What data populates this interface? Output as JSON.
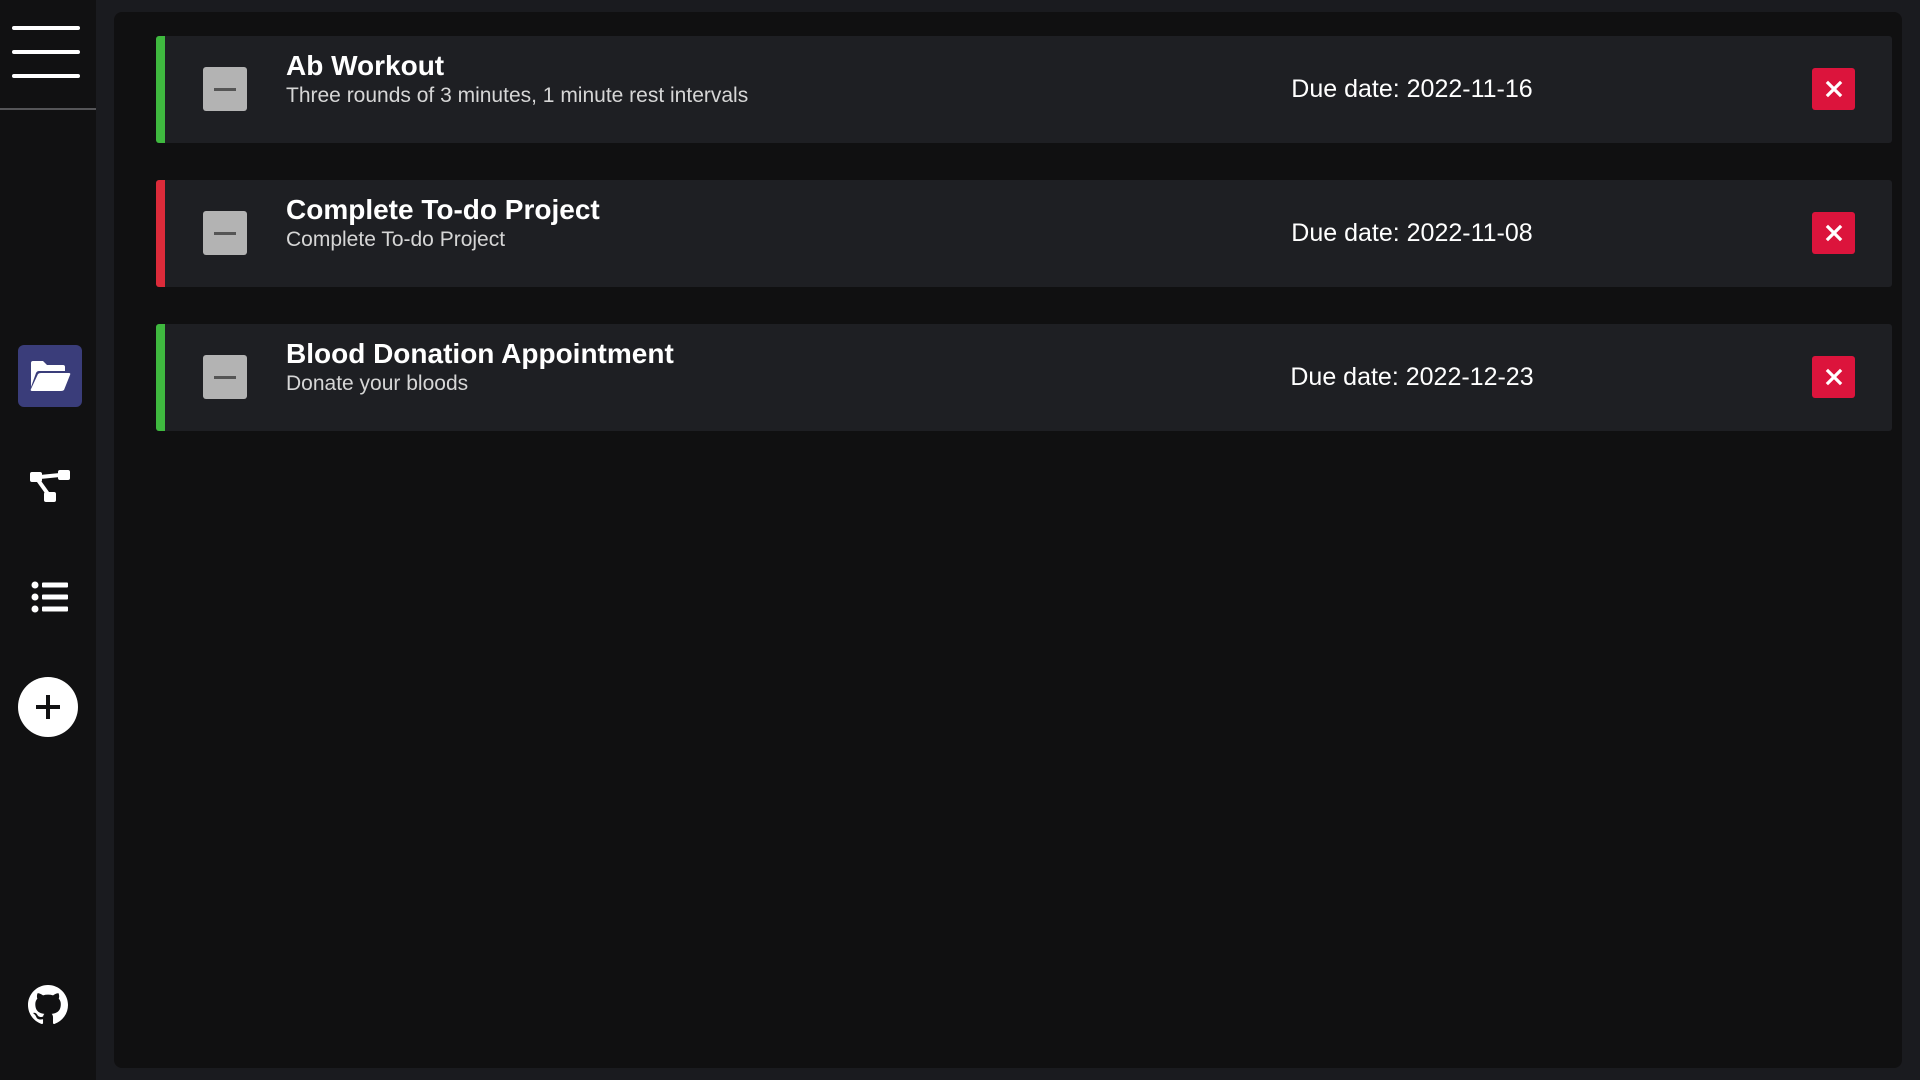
{
  "sidebar": {
    "menu_icon": "hamburger-menu-icon",
    "items": [
      {
        "name": "projects",
        "icon": "folder-open-icon",
        "active": true
      },
      {
        "name": "hierarchy",
        "icon": "sitemap-icon",
        "active": false
      },
      {
        "name": "list",
        "icon": "list-icon",
        "active": false
      }
    ],
    "add_icon": "plus-circle-icon",
    "github_icon": "github-icon"
  },
  "colors": {
    "active_nav": "#3a3d7a",
    "status_green": "#3fb93f",
    "status_red": "#dc2b3a",
    "delete_red": "#dc143c"
  },
  "tasks": [
    {
      "title": "Ab Workout",
      "description": "Three rounds of 3 minutes, 1 minute rest intervals",
      "due": "Due date: 2022-11-16",
      "status_color": "#3fb93f"
    },
    {
      "title": "Complete To-do Project",
      "description": "Complete To-do Project",
      "due": "Due date: 2022-11-08",
      "status_color": "#dc2b3a"
    },
    {
      "title": "Blood Donation Appointment",
      "description": "Donate your bloods",
      "due": "Due date: 2022-12-23",
      "status_color": "#3fb93f"
    }
  ]
}
